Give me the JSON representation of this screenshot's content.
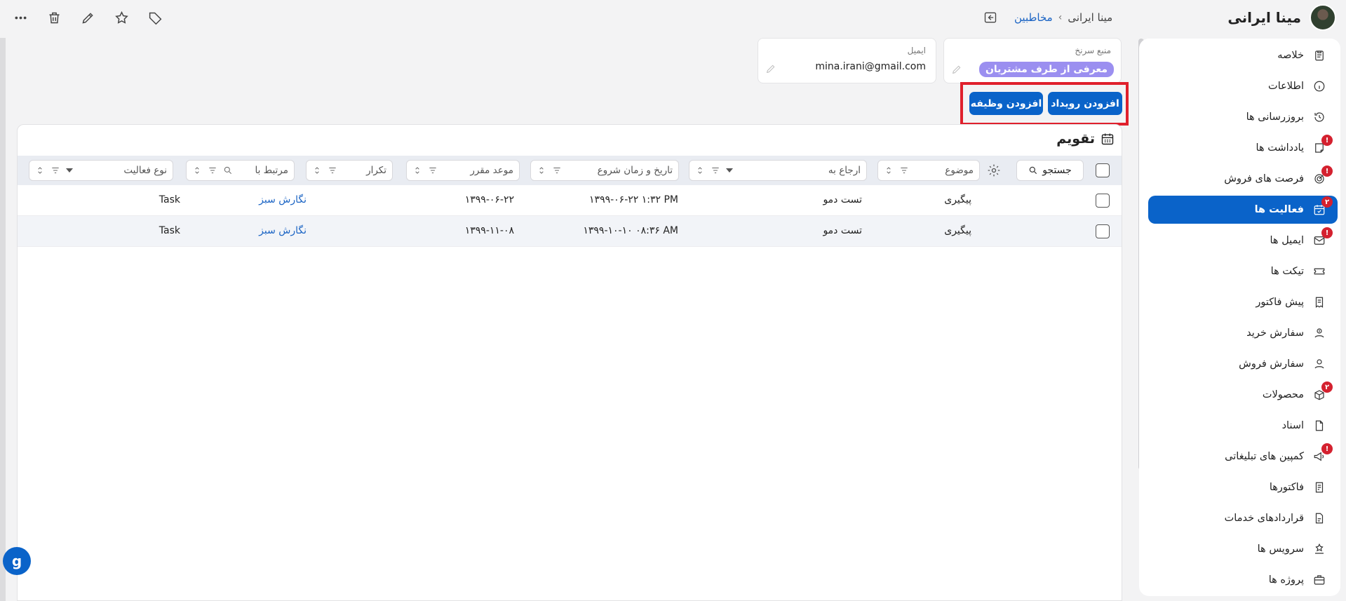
{
  "header": {
    "contact_name": "مینا ایرانی",
    "breadcrumb": {
      "parent": "مخاطبین",
      "separator": "›",
      "current": "مینا ایرانی"
    },
    "toolbar_icons": [
      "more-icon",
      "trash-icon",
      "pencil-icon",
      "star-icon",
      "tag-icon"
    ]
  },
  "fields": {
    "lead_source": {
      "label": "منبع سرنخ",
      "value": "معرفی از طرف مشتریان"
    },
    "email": {
      "label": "ایمیل",
      "value": "mina.irani@gmail.com"
    }
  },
  "actions": {
    "add_event": "افزودن رویداد",
    "add_task": "افزودن وظیفه"
  },
  "panel": {
    "title": "تقویم",
    "search_label": "جستجو",
    "filters": {
      "subject": "موضوع",
      "assigned_to": "ارجاع به",
      "start_datetime": "تاریخ و زمان شروع",
      "due_date": "موعد مقرر",
      "repeat": "تکرار",
      "related_to": "مرتبط با",
      "activity_type": "نوع فعالیت"
    },
    "rows": [
      {
        "subject": "پیگیری",
        "assigned_to": "تست دمو",
        "start": "۱۳۹۹-۰۶-۲۲ ۱:۳۲ PM",
        "due": "۱۳۹۹-۰۶-۲۲",
        "repeat": "",
        "related": "نگارش سبز",
        "type": "Task"
      },
      {
        "subject": "پیگیری",
        "assigned_to": "تست دمو",
        "start": "۱۳۹۹-۱۰-۱۰ ۰۸:۳۶ AM",
        "due": "۱۳۹۹-۱۱-۰۸",
        "repeat": "",
        "related": "نگارش سبز",
        "type": "Task"
      }
    ]
  },
  "sidebar": {
    "items": [
      {
        "label": "خلاصه",
        "icon": "clipboard-icon",
        "badge": ""
      },
      {
        "label": "اطلاعات",
        "icon": "info-icon",
        "badge": ""
      },
      {
        "label": "بروزرسانی ها",
        "icon": "history-icon",
        "badge": ""
      },
      {
        "label": "یادداشت ها",
        "icon": "note-icon",
        "badge": "!"
      },
      {
        "label": "فرصت های فروش",
        "icon": "target-icon",
        "badge": "!"
      },
      {
        "label": "فعالیت ها",
        "icon": "calendar-check-icon",
        "badge": "۲",
        "active": true
      },
      {
        "label": "ایمیل ها",
        "icon": "mail-icon",
        "badge": "!"
      },
      {
        "label": "تیکت ها",
        "icon": "ticket-icon",
        "badge": ""
      },
      {
        "label": "پیش فاکتور",
        "icon": "invoice-draft-icon",
        "badge": ""
      },
      {
        "label": "سفارش خرید",
        "icon": "purchase-order-icon",
        "badge": ""
      },
      {
        "label": "سفارش فروش",
        "icon": "sales-order-icon",
        "badge": ""
      },
      {
        "label": "محصولات",
        "icon": "box-icon",
        "badge": "۲"
      },
      {
        "label": "اسناد",
        "icon": "document-icon",
        "badge": ""
      },
      {
        "label": "کمپین های تبلیغاتی",
        "icon": "megaphone-icon",
        "badge": "!"
      },
      {
        "label": "فاکتورها",
        "icon": "receipt-icon",
        "badge": ""
      },
      {
        "label": "قراردادهای خدمات",
        "icon": "contract-icon",
        "badge": ""
      },
      {
        "label": "سرویس ها",
        "icon": "service-icon",
        "badge": ""
      },
      {
        "label": "پروژه ها",
        "icon": "briefcase-icon",
        "badge": ""
      }
    ]
  },
  "help_fab": {
    "glyph": "g"
  }
}
